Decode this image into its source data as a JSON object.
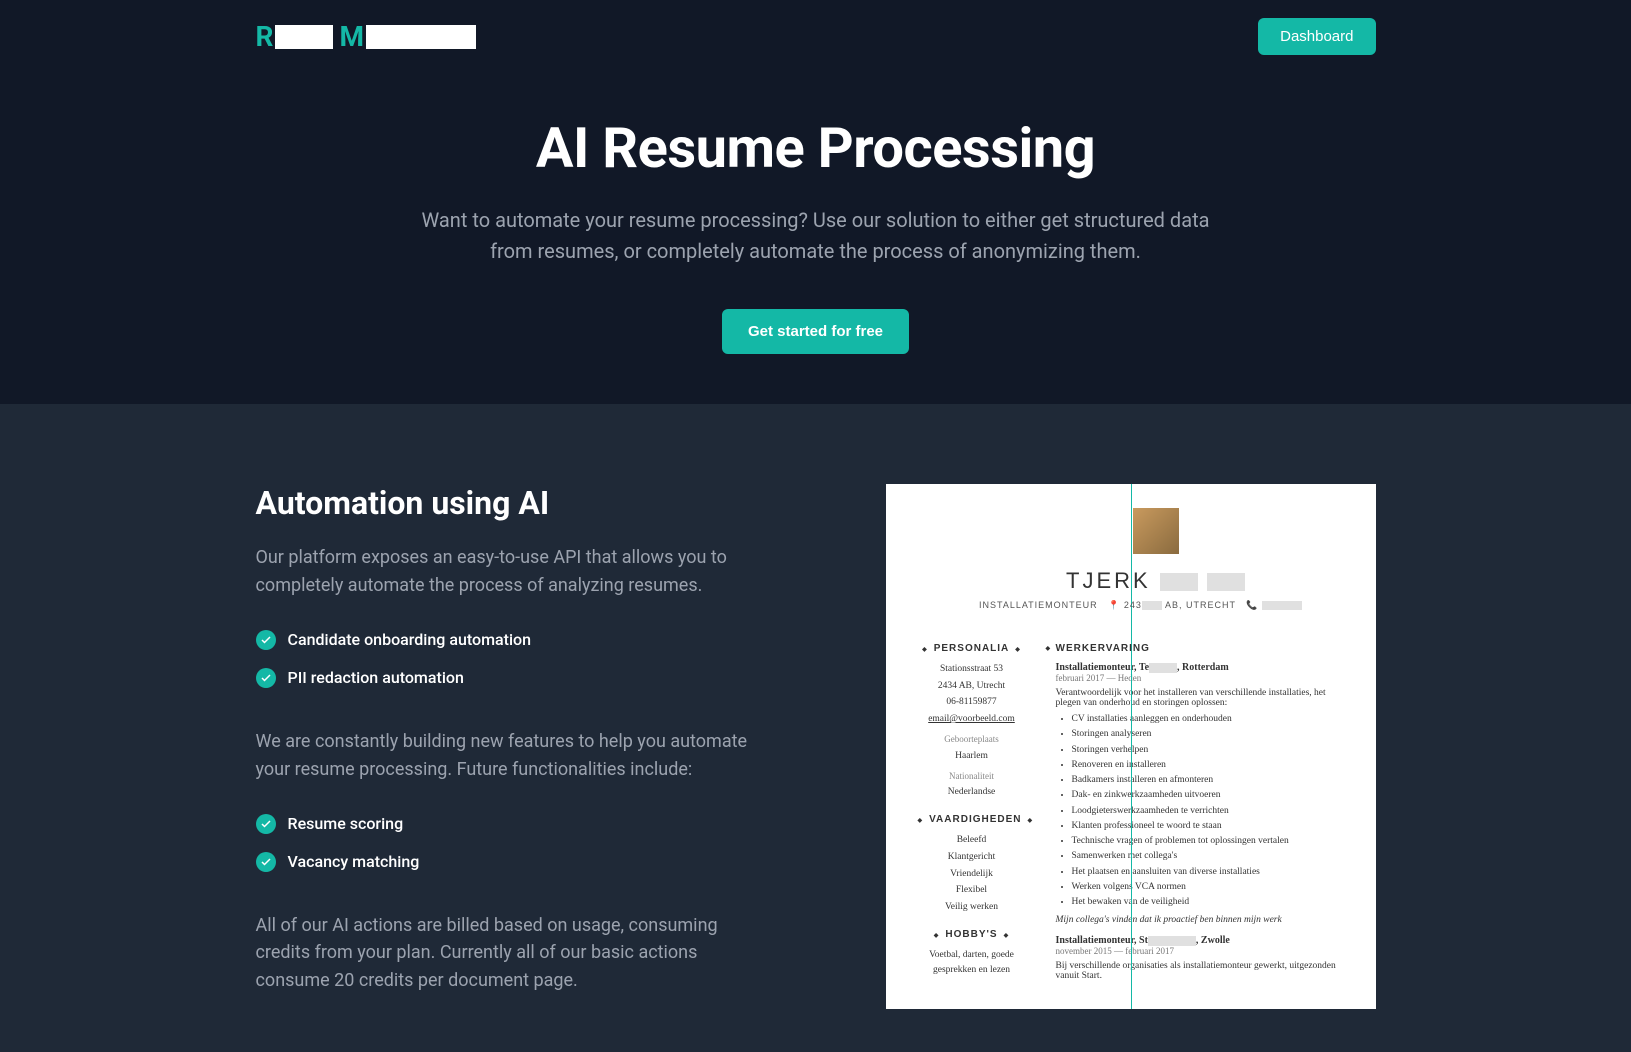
{
  "header": {
    "dashboard_label": "Dashboard"
  },
  "hero": {
    "title": "AI Resume Processing",
    "subtitle": "Want to automate your resume processing? Use our solution to either get structured data from resumes, or completely automate the process of anonymizing them.",
    "cta_label": "Get started for free"
  },
  "section": {
    "title": "Automation using AI",
    "para1": "Our platform exposes an easy-to-use API that allows you to completely automate the process of analyzing resumes.",
    "features_current": [
      "Candidate onboarding automation",
      "PII redaction automation"
    ],
    "para2": "We are constantly building new features to help you automate your resume processing. Future functionalities include:",
    "features_future": [
      "Resume scoring",
      "Vacancy matching"
    ],
    "para3": "All of our AI actions are billed based on usage, consuming credits from your plan. Currently all of our basic actions consume 20 credits per document page."
  },
  "resume": {
    "name_visible": "TJERK",
    "meta_role": "INSTALLATIEMONTEUR",
    "meta_addr_p1": "243",
    "meta_addr_p2": "AB, UTRECHT",
    "personalia_head": "PERSONALIA",
    "addr1": "Stationsstraat 53",
    "addr2": "2434 AB, Utrecht",
    "phone": "06-81159877",
    "email": "email@voorbeeld.com",
    "birth_label": "Geboorteplaats",
    "birth_val": "Haarlem",
    "nat_label": "Nationaliteit",
    "nat_val": "Nederlandse",
    "skills_head": "VAARDIGHEDEN",
    "skills": [
      "Beleefd",
      "Klantgericht",
      "Vriendelijk",
      "Flexibel",
      "Veilig werken"
    ],
    "hobby_head": "HOBBY'S",
    "hobby_text": "Voetbal, darten, goede gesprekken en lezen",
    "exp_head": "WERKERVARING",
    "job1_title_p1": "Installatiemonteur, Te",
    "job1_title_p2": ", Rotterdam",
    "job1_date": "februari 2017 — Heden",
    "job1_desc": "Verantwoordelijk voor het installeren van verschillende installaties, het plegen van onderhoud en storingen oplossen:",
    "job1_bullets": [
      "CV installaties aanleggen en onderhouden",
      "Storingen analyseren",
      "Storingen verhelpen",
      "Renoveren en installeren",
      "Badkamers installeren en afmonteren",
      "Dak- en zinkwerkzaamheden uitvoeren",
      "Loodgieterswerkzaamheden te verrichten",
      "Klanten professioneel te woord te staan",
      "Technische vragen of problemen tot oplossingen vertalen",
      "Samenwerken met collega's",
      "Het plaatsen en aansluiten van diverse installaties",
      "Werken volgens VCA normen",
      "Het bewaken van de veiligheid"
    ],
    "job1_quote": "Mijn collega's vinden dat ik proactief ben binnen mijn werk",
    "job2_title_p1": "Installatiemonteur, St",
    "job2_title_p2": ", Zwolle",
    "job2_date": "november 2015 — februari 2017",
    "job2_desc": "Bij verschillende organisaties als installatiemonteur gewerkt, uitgezonden vanuit Start."
  }
}
